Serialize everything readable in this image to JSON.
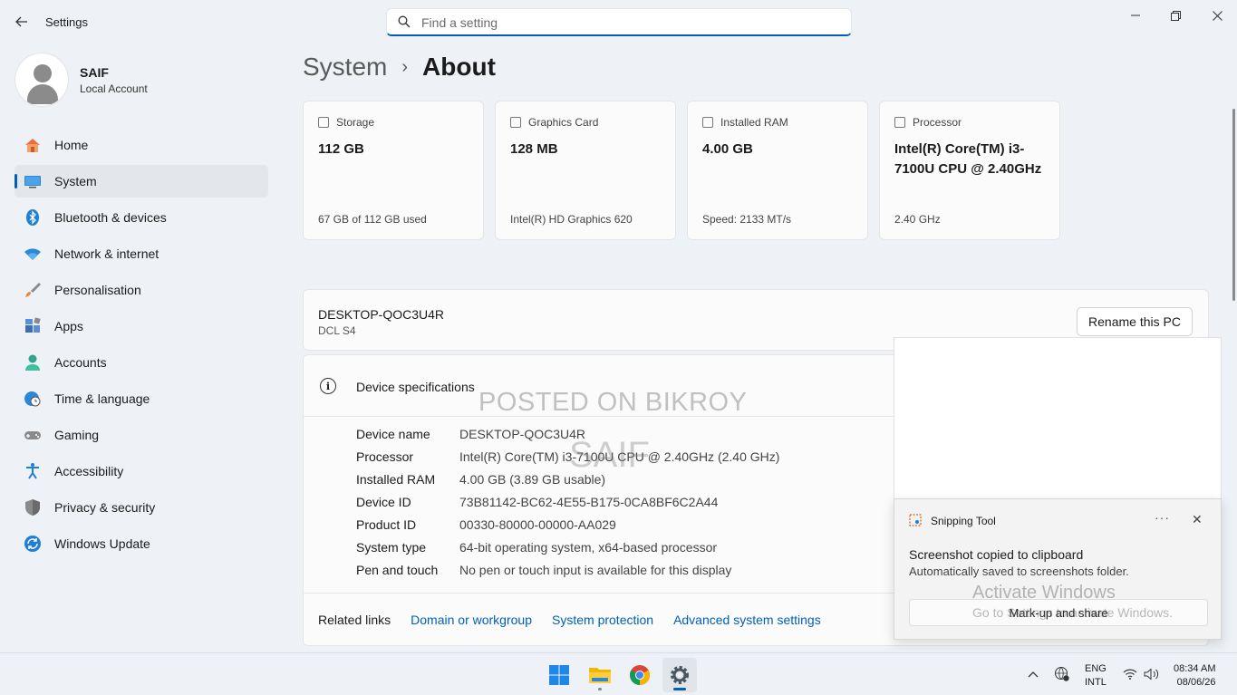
{
  "window": {
    "title": "Settings",
    "search_placeholder": "Find a setting"
  },
  "profile": {
    "name": "SAIF",
    "account_type": "Local Account"
  },
  "sidebar": {
    "items": [
      {
        "label": "Home",
        "icon": "home-icon"
      },
      {
        "label": "System",
        "icon": "system-icon",
        "active": true
      },
      {
        "label": "Bluetooth & devices",
        "icon": "bluetooth-icon"
      },
      {
        "label": "Network & internet",
        "icon": "wifi-icon"
      },
      {
        "label": "Personalisation",
        "icon": "brush-icon"
      },
      {
        "label": "Apps",
        "icon": "apps-icon"
      },
      {
        "label": "Accounts",
        "icon": "accounts-icon"
      },
      {
        "label": "Time & language",
        "icon": "globe-clock-icon"
      },
      {
        "label": "Gaming",
        "icon": "gamepad-icon"
      },
      {
        "label": "Accessibility",
        "icon": "accessibility-icon"
      },
      {
        "label": "Privacy & security",
        "icon": "shield-icon"
      },
      {
        "label": "Windows Update",
        "icon": "update-icon"
      }
    ]
  },
  "breadcrumb": {
    "parent": "System",
    "separator": "›",
    "current": "About"
  },
  "cards": [
    {
      "title": "Storage",
      "value": "112 GB",
      "footer": "67 GB of 112 GB used"
    },
    {
      "title": "Graphics Card",
      "value": "128 MB",
      "footer": "Intel(R) HD Graphics 620"
    },
    {
      "title": "Installed RAM",
      "value": "4.00 GB",
      "footer": "Speed: 2133 MT/s"
    },
    {
      "title": "Processor",
      "value": "Intel(R) Core(TM) i3-7100U CPU @ 2.40GHz",
      "footer": "2.40 GHz"
    }
  ],
  "pc": {
    "name": "DESKTOP-QOC3U4R",
    "model": "DCL S4",
    "rename_label": "Rename this PC"
  },
  "specs": {
    "title": "Device specifications",
    "rows": [
      {
        "label": "Device name",
        "value": "DESKTOP-QOC3U4R"
      },
      {
        "label": "Processor",
        "value": "Intel(R) Core(TM) i3-7100U CPU @ 2.40GHz (2.40 GHz)"
      },
      {
        "label": "Installed RAM",
        "value": "4.00 GB (3.89 GB usable)"
      },
      {
        "label": "Device ID",
        "value": "73B81142-BC62-4E55-B175-0CA8BF6C2A44"
      },
      {
        "label": "Product ID",
        "value": "00330-80000-00000-AA029"
      },
      {
        "label": "System type",
        "value": "64-bit operating system, x64-based processor"
      },
      {
        "label": "Pen and touch",
        "value": "No pen or touch input is available for this display"
      }
    ],
    "related_label": "Related links",
    "related_links": [
      "Domain or workgroup",
      "System protection",
      "Advanced system settings"
    ]
  },
  "watermark": {
    "line1": "POSTED ON BIKROY",
    "line2": "SAIF"
  },
  "toast": {
    "app": "Snipping Tool",
    "more": "···",
    "close": "✕",
    "title": "Screenshot copied to clipboard",
    "body": "Automatically saved to screenshots folder.",
    "button": "Mark-up and share"
  },
  "activation": {
    "title": "Activate Windows",
    "subtitle": "Go to Settings to activate Windows."
  },
  "taskbar": {
    "apps": [
      "start-icon",
      "file-explorer-icon",
      "chrome-icon",
      "settings-icon"
    ],
    "lang_line1": "ENG",
    "lang_line2": "INTL",
    "time": "08:34 AM",
    "date": "08/06/26"
  },
  "colors": {
    "accent": "#005fb8",
    "background": "#eef2f6",
    "card": "#fbfbfb"
  }
}
